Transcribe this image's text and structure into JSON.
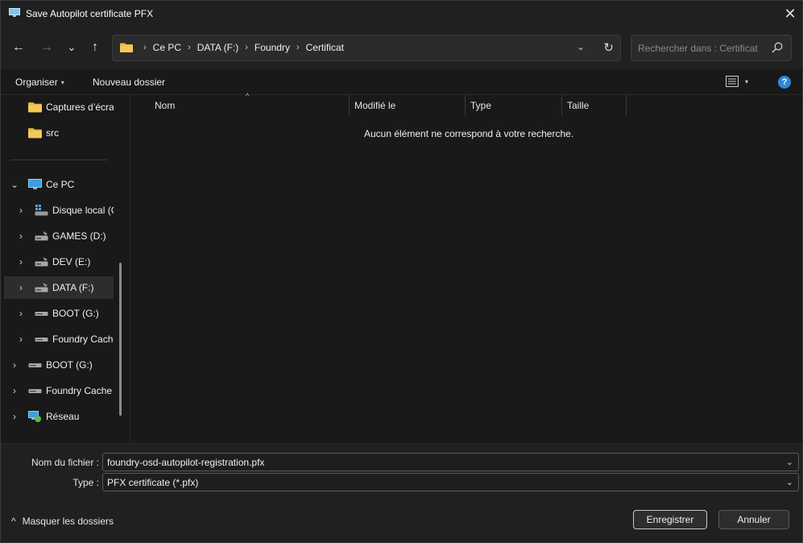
{
  "window": {
    "title": "Save Autopilot certificate PFX",
    "close_glyph": "✕",
    "app_icon": "computer-icon"
  },
  "nav_buttons": {
    "back": "←",
    "forward": "→",
    "recent": "⌄",
    "up": "↑"
  },
  "address": {
    "crumbs": [
      "Ce PC",
      "DATA (F:)",
      "Foundry",
      "Certificat"
    ],
    "separator": "›",
    "dropdown_glyph": "⌄",
    "refresh_glyph": "↻"
  },
  "search": {
    "placeholder": "Rechercher dans : Certificat"
  },
  "toolbar": {
    "organize": "Organiser",
    "new_folder": "Nouveau dossier",
    "caret": "▾",
    "view_glyph": "☰",
    "help": "?"
  },
  "nav": {
    "items": [
      {
        "label": "Captures d’écran",
        "icon": "folder-icon",
        "chevron": ""
      },
      {
        "label": "src",
        "icon": "folder-icon",
        "chevron": ""
      },
      {
        "label": "Ce PC",
        "icon": "pc-icon",
        "chevron": "⌄"
      },
      {
        "label": "Disque local (C:)",
        "icon": "windows-drive-icon",
        "chevron": "›"
      },
      {
        "label": "GAMES (D:)",
        "icon": "drive-icon",
        "chevron": "›"
      },
      {
        "label": "DEV (E:)",
        "icon": "drive-icon",
        "chevron": "›"
      },
      {
        "label": "DATA (F:)",
        "icon": "drive-icon",
        "chevron": "›"
      },
      {
        "label": "BOOT (G:)",
        "icon": "removable-drive-icon",
        "chevron": "›"
      },
      {
        "label": "Foundry Cache",
        "icon": "removable-drive-icon",
        "chevron": "›"
      },
      {
        "label": "BOOT (G:)",
        "icon": "removable-drive-icon",
        "chevron": "›"
      },
      {
        "label": "Foundry Cache",
        "icon": "removable-drive-icon",
        "chevron": "›"
      },
      {
        "label": "Réseau",
        "icon": "network-icon",
        "chevron": "›"
      }
    ]
  },
  "filelist": {
    "columns": [
      "Nom",
      "Modifié le",
      "Type",
      "Taille"
    ],
    "sort_glyph": "^",
    "empty_message": "Aucun élément ne correspond à votre recherche."
  },
  "form": {
    "filename_label": "Nom du fichier :",
    "filename_value": "foundry-osd-autopilot-registration.pfx",
    "type_label": "Type :",
    "type_value": "PFX certificate (*.pfx)",
    "dropdown_glyph": "⌄"
  },
  "footer": {
    "hide_folders": "Masquer les dossiers",
    "hide_glyph": "^",
    "save_button": "Enregistrer",
    "cancel_button": "Annuler"
  },
  "colors": {
    "background": "#191919",
    "chrome": "#202020",
    "accent": "#2c88d9",
    "folder": "#e8b640"
  }
}
